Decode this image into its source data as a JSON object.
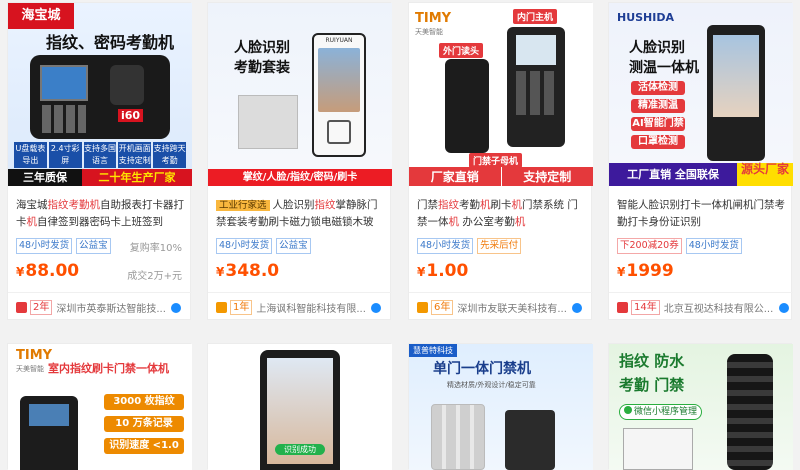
{
  "cards": [
    {
      "img": {
        "brand": "海宝城",
        "headline": "指纹、密码考勤机",
        "device_model": "i60",
        "features": [
          "U盘载表导出",
          "2.4寸彩屏",
          "支持多国语言",
          "开机画面支持定制",
          "支持跨天考勤"
        ],
        "banner_left": "三年质保",
        "banner_right": "二十年生产厂家"
      },
      "title_parts": [
        "海宝城",
        "指纹",
        "考勤机",
        "自助报表打卡器打卡",
        "机",
        "自律签到器密码卡上班签到"
      ],
      "tags": [
        "48小时发货",
        "公益宝"
      ],
      "repeat": "复购率10%",
      "price": "88.00",
      "deals": "成交2万+元",
      "years": "2年",
      "shop": "深圳市英泰斯达智能技..."
    },
    {
      "img": {
        "headline": "人脸识别",
        "subline": "考勤套装",
        "banner": "掌纹/人脸/指纹/密码/刷卡",
        "device_brand": "RUIYUAN"
      },
      "industry_tag": "工业行家选",
      "title_parts": [
        "人脸识别",
        "指纹",
        "掌静脉门禁套装考勤刷卡磁力锁电磁锁木玻"
      ],
      "tags": [
        "48小时发货",
        "公益宝"
      ],
      "price": "348.0",
      "years": "1年",
      "shop": "上海讽科智能科技有限..."
    },
    {
      "img": {
        "brand": "TIMY",
        "brand_sub": "天美智能",
        "label_host": "内门主机",
        "label_reader": "外门读头",
        "label_combo": "门禁子母机",
        "banner_left": "厂家直销",
        "banner_right": "支持定制"
      },
      "title_parts": [
        "门禁",
        "指纹",
        "考勤",
        "机",
        "刷卡",
        "机",
        "门禁系统 门禁一体",
        "机",
        " 办公室考勤",
        "机"
      ],
      "tags": [
        "48小时发货",
        "先采后付"
      ],
      "price": "1.00",
      "years": "6年",
      "shop": "深圳市友联天美科技有..."
    },
    {
      "img": {
        "brand": "HUSHIDA",
        "headline": "人脸识别",
        "subline": "测温一体机",
        "chips": [
          "活体检测",
          "精准测温",
          "AI智能门禁",
          "口罩检测"
        ],
        "banner_left": "工厂直销 全国联保",
        "banner_right": "源头厂家"
      },
      "title_parts": [
        "智能人脸识别打卡一体机闸机门禁考勤打卡身份证识别"
      ],
      "tags": [
        "下200减20券",
        "48小时发货"
      ],
      "price": "1999",
      "years": "14年",
      "shop": "北京互视达科技有限公..."
    },
    {
      "img": {
        "brand": "TIMY",
        "brand_sub": "天美智能",
        "headline": "室内指纹刷卡门禁一体机",
        "specs": [
          "3000 枚指纹",
          "10 万条记录",
          "识别速度 <1.0 秒"
        ]
      }
    },
    {
      "img": {
        "caption": "识别成功"
      }
    },
    {
      "img": {
        "brand": "慧普特科技",
        "headline": "单门一体门禁机",
        "subline": "精选材质/外观设计/稳定可靠"
      }
    },
    {
      "img": {
        "headline_1": "指纹 防水",
        "headline_2": "考勤 门禁",
        "wechat": "微信小程序管理"
      }
    }
  ]
}
